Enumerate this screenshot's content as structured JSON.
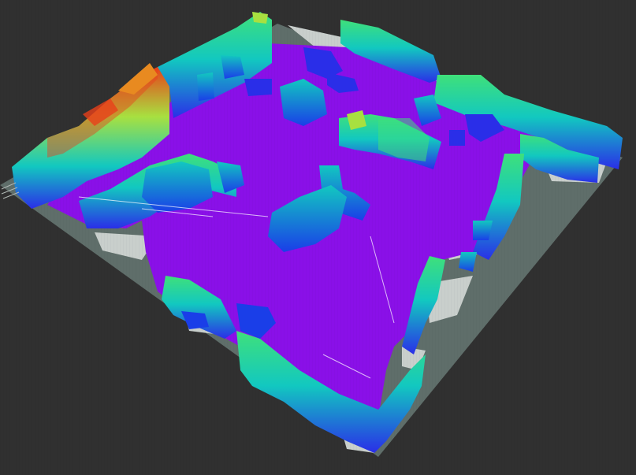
{
  "viewport": {
    "background_color": "#303030",
    "grid_color": "#5f6e6a",
    "free_space_color": "#c9cfcc",
    "floor_color": "#8a10e8",
    "height_colormap": [
      "#7a0fe8",
      "#2a2ee8",
      "#1a7de0",
      "#12c8c0",
      "#3fe07a",
      "#a8e040",
      "#e88a20",
      "#e8401a"
    ]
  }
}
